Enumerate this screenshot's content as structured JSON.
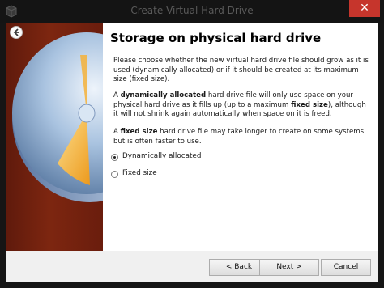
{
  "window": {
    "title": "Create Virtual Hard Drive",
    "close_glyph": "✕"
  },
  "page": {
    "heading": "Storage on physical hard drive",
    "paragraph1": "Please choose whether the new virtual hard drive file should grow as it is used (dynamically allocated) or if it should be created at its maximum size (fixed size).",
    "paragraph2": {
      "prefix": "A ",
      "term": "dynamically allocated",
      "middle": " hard drive file will only use space on your physical hard drive as it fills up (up to a maximum ",
      "term2": "fixed size",
      "suffix": "), although it will not shrink again automatically when space on it is freed."
    },
    "paragraph3": {
      "prefix": "A ",
      "term": "fixed size",
      "suffix": " hard drive file may take longer to create on some systems but is often faster to use."
    }
  },
  "options": [
    {
      "label": "Dynamically allocated",
      "selected": true
    },
    {
      "label": "Fixed size",
      "selected": false
    }
  ],
  "buttons": {
    "back": "< Back",
    "next": "Next >",
    "cancel": "Cancel"
  },
  "colors": {
    "titlebar": "#141414",
    "close": "#c6352c",
    "sidebar": "#7d2610",
    "footer": "#f0f0f0"
  },
  "icons": [
    "app-icon",
    "close-icon",
    "back-arrow-icon",
    "hard-drive-disk-icon"
  ]
}
